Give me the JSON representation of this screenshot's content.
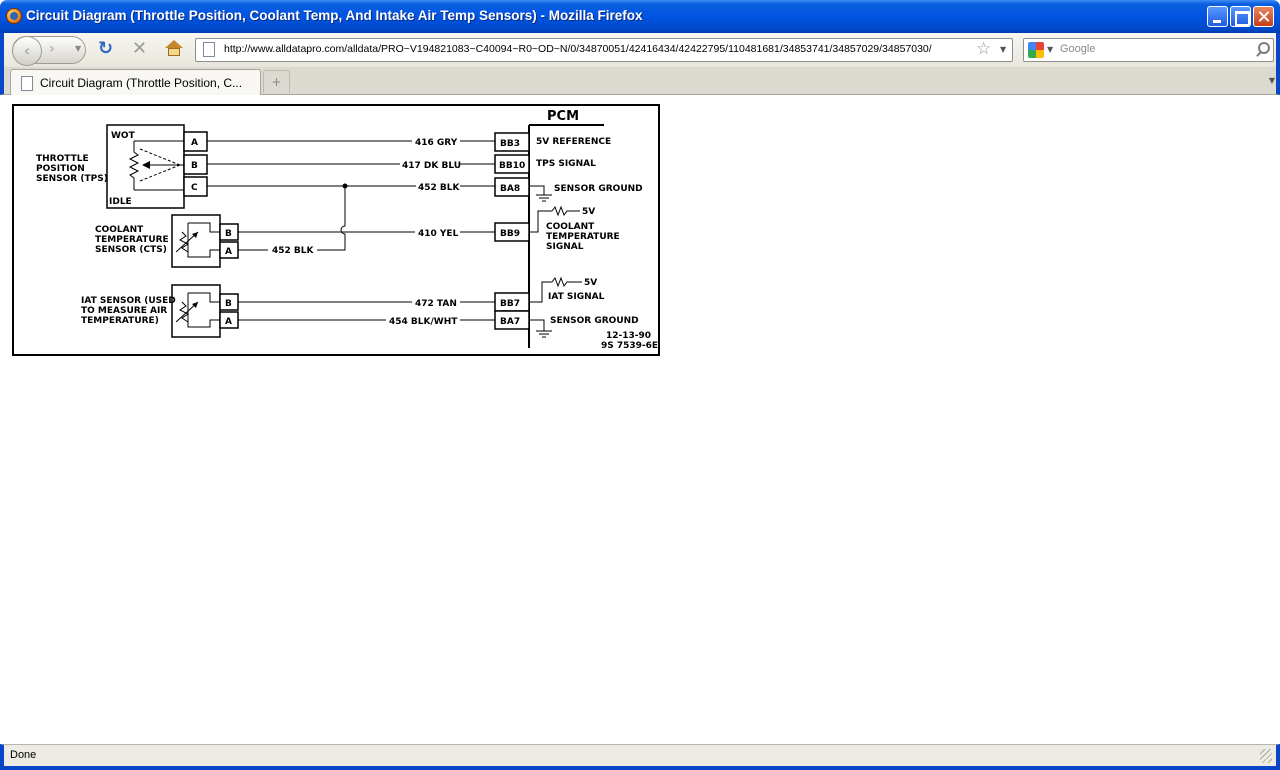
{
  "window": {
    "title": "Circuit Diagram (Throttle Position, Coolant Temp, And Intake Air Temp Sensors) - Mozilla Firefox"
  },
  "toolbar": {
    "url": "http://www.alldatapro.com/alldata/PRO~V194821083~C40094~R0~OD~N/0/34870051/42416434/42422795/110481681/34853741/34857029/34857030/",
    "search_placeholder": "Google"
  },
  "tabs": [
    {
      "label": "Circuit Diagram (Throttle Position, C..."
    }
  ],
  "diagram": {
    "pcm": "PCM",
    "tps": {
      "line1": "THROTTLE",
      "line2": "POSITION",
      "line3": "SENSOR (TPS)",
      "wot": "WOT",
      "idle": "IDLE",
      "pins": [
        "A",
        "B",
        "C"
      ]
    },
    "cts": {
      "line1": "COOLANT",
      "line2": "TEMPERATURE",
      "line3": "SENSOR (CTS)",
      "pins": [
        "B",
        "A"
      ]
    },
    "iat": {
      "line1": "IAT SENSOR (USED",
      "line2": "TO MEASURE AIR",
      "line3": "TEMPERATURE)",
      "pins": [
        "B",
        "A"
      ]
    },
    "wires": {
      "w416": "416 GRY",
      "w417": "417 DK BLU",
      "w452a": "452 BLK",
      "w410": "410 YEL",
      "w452b": "452 BLK",
      "w472": "472 TAN",
      "w454": "454 BLK/WHT"
    },
    "terminals": {
      "bb3": "BB3",
      "bb10": "BB10",
      "ba8": "BA8",
      "bb9": "BB9",
      "bb7": "BB7",
      "ba7": "BA7"
    },
    "signals": {
      "ref": "5V REFERENCE",
      "tps": "TPS SIGNAL",
      "gnd1": "SENSOR GROUND",
      "v5a": "5V",
      "cts1": "COOLANT",
      "cts2": "TEMPERATURE",
      "cts3": "SIGNAL",
      "v5b": "5V",
      "iat": "IAT SIGNAL",
      "gnd2": "SENSOR GROUND"
    },
    "date": "12-13-90",
    "code": "9S 7539-6E"
  },
  "status": {
    "text": "Done"
  }
}
